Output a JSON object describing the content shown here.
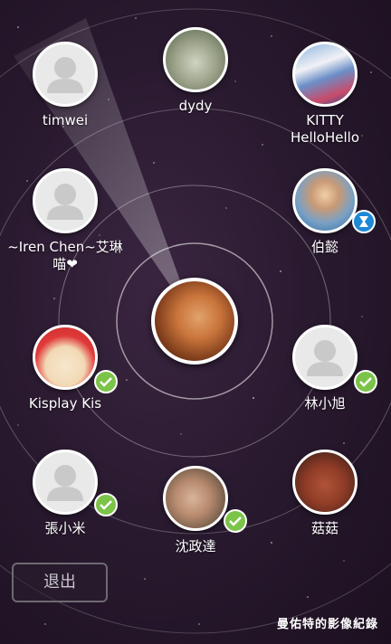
{
  "contacts": [
    {
      "name": "timwei",
      "kind": "placeholder",
      "badge": ""
    },
    {
      "name": "dydy",
      "kind": "photo-sheep",
      "badge": ""
    },
    {
      "name": "KITTY HelloHello",
      "kind": "photo-city",
      "badge": ""
    },
    {
      "name": "~Iren Chen~艾琳喵❤",
      "kind": "placeholder",
      "badge": ""
    },
    {
      "name": "伯懿",
      "kind": "photo-man-glasses",
      "badge": "hourglass"
    },
    {
      "name": "Kisplay Kis",
      "kind": "photo-cartoon",
      "badge": "check"
    },
    {
      "name": "林小旭",
      "kind": "placeholder",
      "badge": "check"
    },
    {
      "name": "張小米",
      "kind": "placeholder",
      "badge": "check"
    },
    {
      "name": "沈政達",
      "kind": "photo-face",
      "badge": "check"
    },
    {
      "name": "菇菇",
      "kind": "photo-plush",
      "badge": ""
    }
  ],
  "center": {
    "kind": "photo-self"
  },
  "exit_label": "退出",
  "watermark": "曼佑特的影像紀錄",
  "colors": {
    "check": "#7cc34a",
    "hourglass": "#1e88d6",
    "ring": "#ffffff"
  }
}
